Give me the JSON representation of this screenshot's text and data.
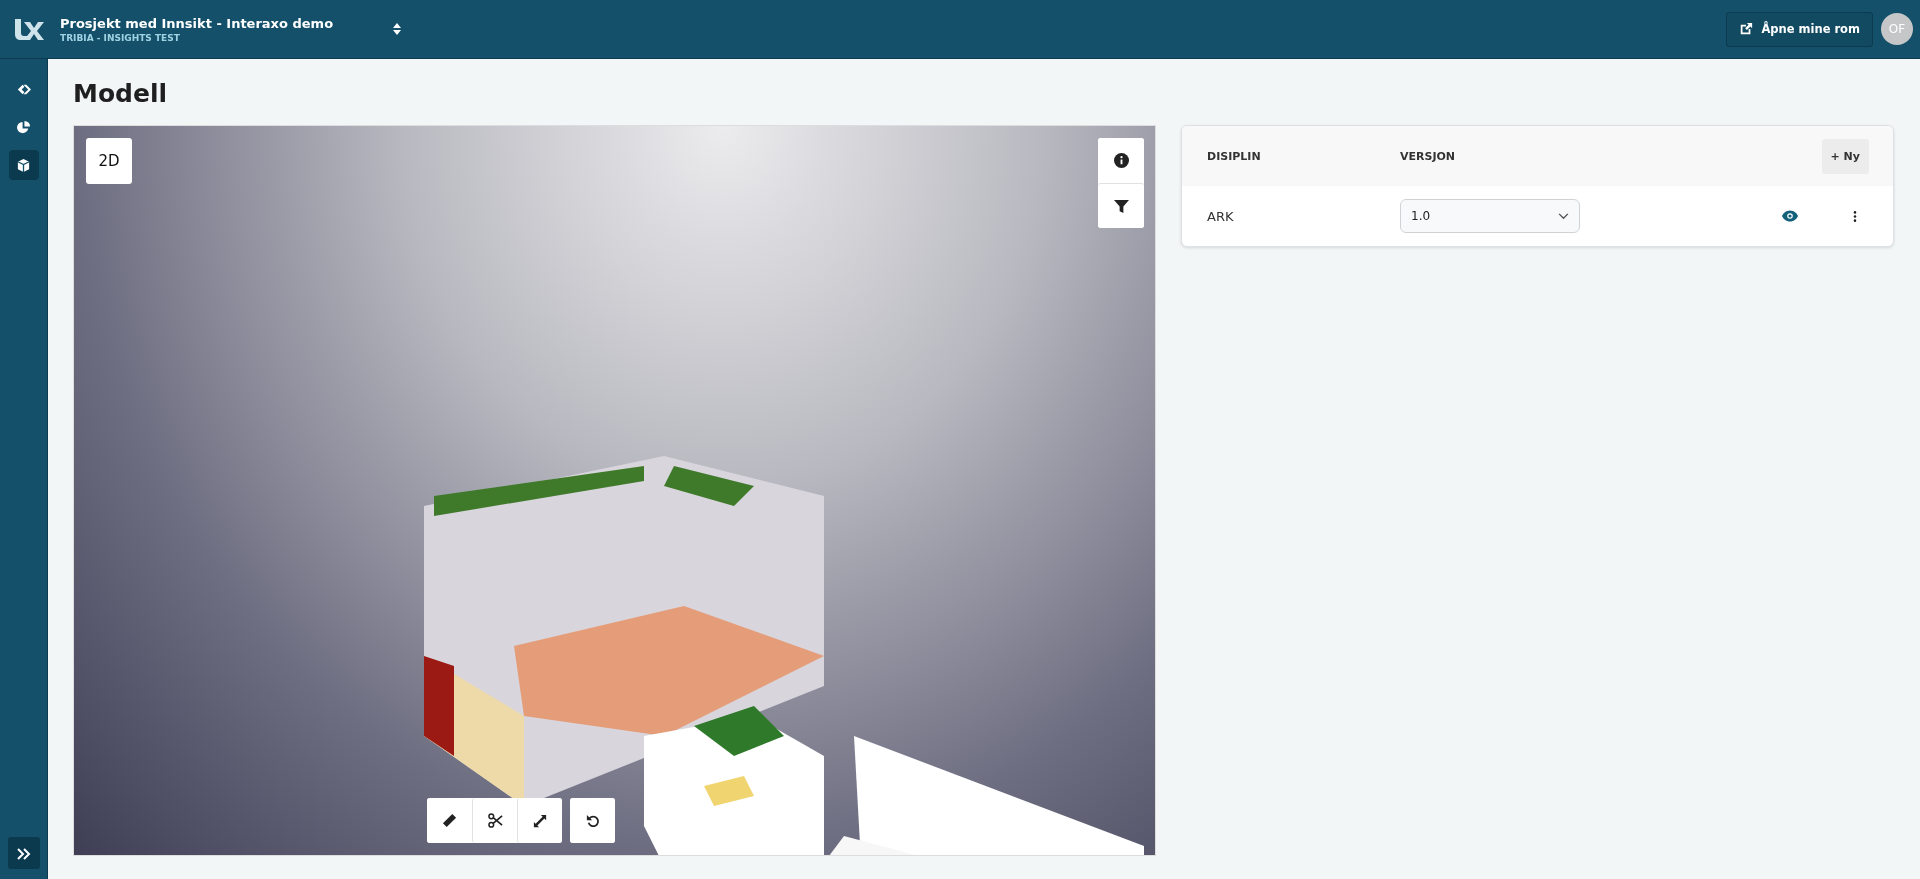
{
  "header": {
    "project_title": "Prosjekt med Innsikt - Interaxo demo",
    "organization": "TRIBIA - INSIGHTS TEST",
    "open_rooms_button": "Åpne mine rom",
    "avatar_initials": "OF"
  },
  "sidebar": {
    "items": [
      {
        "kind": "navigate",
        "selected": false
      },
      {
        "kind": "chart",
        "selected": false
      },
      {
        "kind": "model",
        "selected": true
      }
    ]
  },
  "page_title": "Modell",
  "viewer": {
    "mode_button": "2D"
  },
  "table": {
    "columns": [
      "DISIPLIN",
      "VERSJON"
    ],
    "add_button": "+ Ny",
    "rows": [
      {
        "discipline": "ARK",
        "version": "1.0"
      }
    ]
  }
}
